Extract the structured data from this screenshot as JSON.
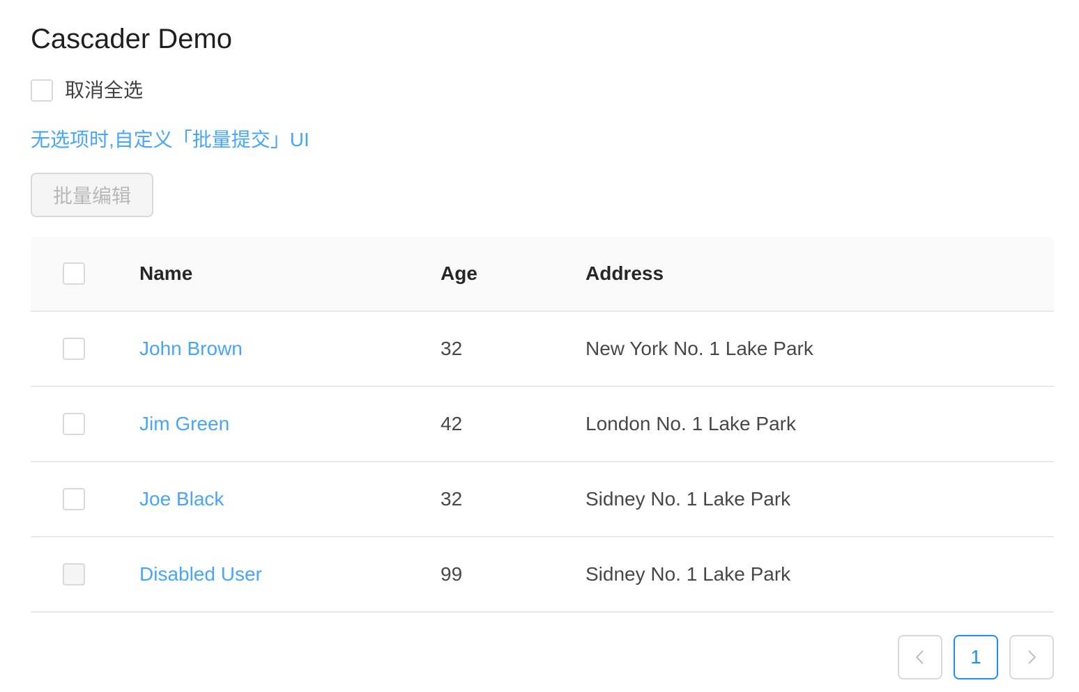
{
  "page": {
    "title": "Cascader Demo"
  },
  "select_all": {
    "label": "取消全选",
    "checked": false
  },
  "custom_link": {
    "text": "无选项时,自定义「批量提交」UI"
  },
  "batch_button": {
    "label": "批量编辑",
    "disabled": true
  },
  "table": {
    "columns": [
      "Name",
      "Age",
      "Address"
    ],
    "rows": [
      {
        "name": "John Brown",
        "age": "32",
        "address": "New York No. 1 Lake Park",
        "checked": false,
        "disabled": false
      },
      {
        "name": "Jim Green",
        "age": "42",
        "address": "London No. 1 Lake Park",
        "checked": false,
        "disabled": false
      },
      {
        "name": "Joe Black",
        "age": "32",
        "address": "Sidney No. 1 Lake Park",
        "checked": false,
        "disabled": false
      },
      {
        "name": "Disabled User",
        "age": "99",
        "address": "Sidney No. 1 Lake Park",
        "checked": false,
        "disabled": true
      }
    ]
  },
  "pagination": {
    "prev_icon": "chevron-left-icon",
    "current_page": "1",
    "next_icon": "chevron-right-icon"
  },
  "colors": {
    "link": "#1890ff",
    "border": "#d9d9d9",
    "header_bg": "#fafafa",
    "disabled_bg": "#f5f5f5"
  }
}
